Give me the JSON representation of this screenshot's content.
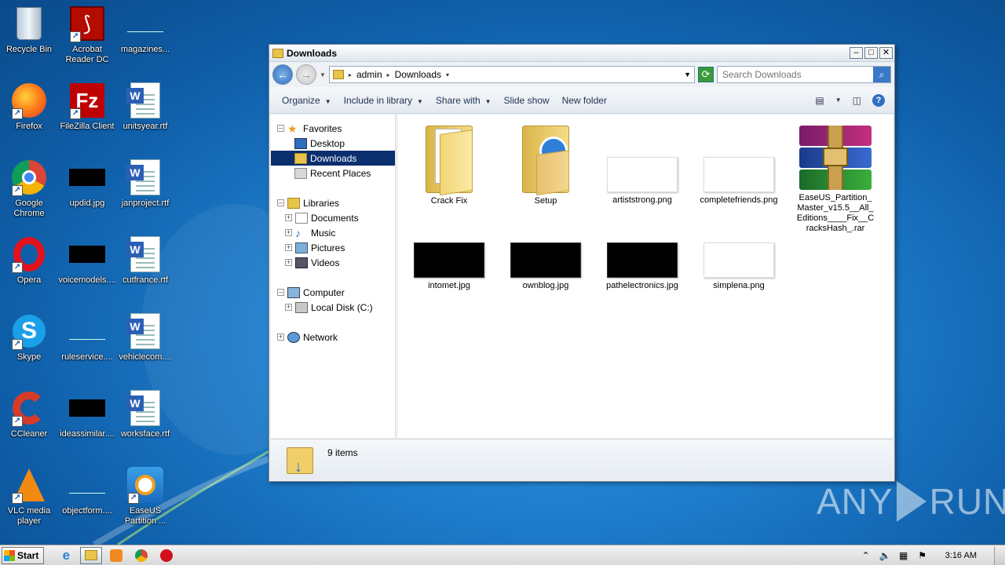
{
  "desktop": {
    "icons": [
      {
        "label": "Recycle Bin",
        "icon": "recycle-bin-icon"
      },
      {
        "label": "Acrobat Reader DC",
        "icon": "acrobat-icon"
      },
      {
        "label": "magazines...",
        "icon": "blank-file-icon"
      },
      {
        "label": "Firefox",
        "icon": "firefox-icon"
      },
      {
        "label": "FileZilla Client",
        "icon": "filezilla-icon"
      },
      {
        "label": "unitsyear.rtf",
        "icon": "word-doc-icon"
      },
      {
        "label": "Google Chrome",
        "icon": "chrome-icon"
      },
      {
        "label": "updid.jpg",
        "icon": "black-image-icon"
      },
      {
        "label": "janproject.rtf",
        "icon": "word-doc-icon"
      },
      {
        "label": "Opera",
        "icon": "opera-icon"
      },
      {
        "label": "voicemodels....",
        "icon": "black-image-icon"
      },
      {
        "label": "cutfrance.rtf",
        "icon": "word-doc-icon"
      },
      {
        "label": "Skype",
        "icon": "skype-icon"
      },
      {
        "label": "ruleservice....",
        "icon": "blank-file-icon"
      },
      {
        "label": "vehiclecom....",
        "icon": "word-doc-icon"
      },
      {
        "label": "CCleaner",
        "icon": "ccleaner-icon"
      },
      {
        "label": "ideassimilar....",
        "icon": "black-image-icon"
      },
      {
        "label": "worksface.rtf",
        "icon": "word-doc-icon"
      },
      {
        "label": "VLC media player",
        "icon": "vlc-icon"
      },
      {
        "label": "objectform....",
        "icon": "blank-file-icon"
      },
      {
        "label": "EaseUS Partition ...",
        "icon": "easeus-icon"
      }
    ]
  },
  "window": {
    "title": "Downloads",
    "breadcrumb": [
      "admin",
      "Downloads"
    ],
    "search_placeholder": "Search Downloads",
    "toolbar": {
      "organize": "Organize",
      "include_in_library": "Include in library",
      "share_with": "Share with",
      "slide_show": "Slide show",
      "new_folder": "New folder"
    },
    "nav": {
      "favorites": "Favorites",
      "desktop": "Desktop",
      "downloads": "Downloads",
      "recent_places": "Recent Places",
      "libraries": "Libraries",
      "documents": "Documents",
      "music": "Music",
      "pictures": "Pictures",
      "videos": "Videos",
      "computer": "Computer",
      "local_disk": "Local Disk (C:)",
      "network": "Network"
    },
    "files": [
      {
        "name": "Crack Fix",
        "type": "folder"
      },
      {
        "name": "Setup",
        "type": "folder"
      },
      {
        "name": "artiststrong.png",
        "type": "white-image"
      },
      {
        "name": "completefriends.png",
        "type": "white-image"
      },
      {
        "name": "EaseUS_Partition_Master_v15.5__All_Editions____Fix__CracksHash_.rar",
        "type": "rar"
      },
      {
        "name": "intomet.jpg",
        "type": "black-image"
      },
      {
        "name": "ownblog.jpg",
        "type": "black-image"
      },
      {
        "name": "pathelectronics.jpg",
        "type": "black-image"
      },
      {
        "name": "simplena.png",
        "type": "white-image"
      }
    ],
    "status": "9 items"
  },
  "watermark": {
    "left": "ANY",
    "right": "RUN"
  },
  "taskbar": {
    "start_label": "Start",
    "clock": "3:16 AM"
  }
}
